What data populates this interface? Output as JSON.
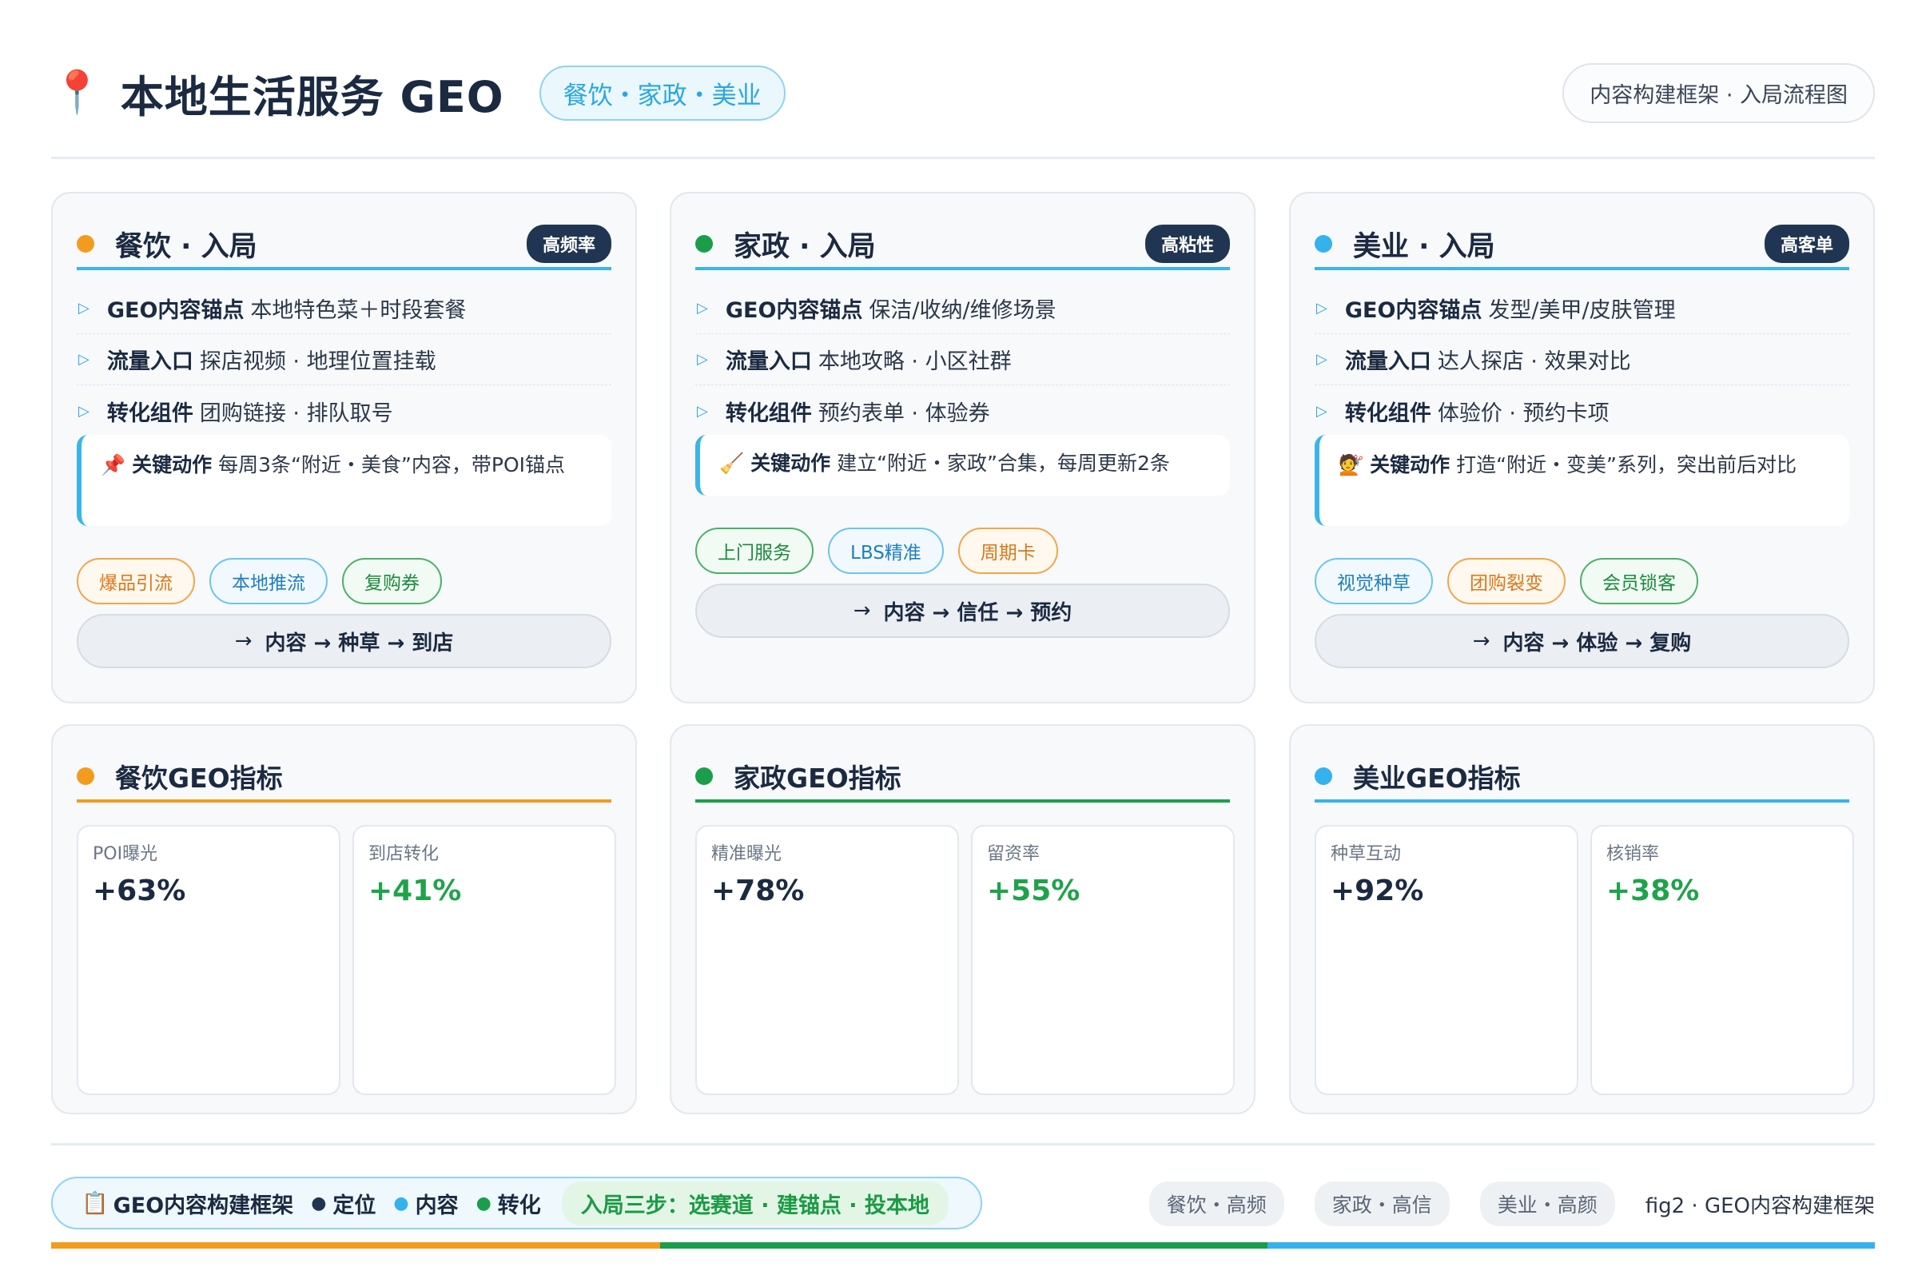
{
  "header": {
    "pin_icon": "📍",
    "title": "本地生活服务 GEO",
    "scope": "餐饮・家政・美业",
    "ref": "内容构建框架 · 入局流程图"
  },
  "colors": {
    "orange": "#f29c1f",
    "green": "#1b9e4b",
    "blue": "#35b2ec"
  },
  "cards": [
    {
      "title": "餐饮 · 入局",
      "badge": "高频率",
      "rows": [
        {
          "label": "GEO内容锚点",
          "text": "本地特色菜＋时段套餐"
        },
        {
          "label": "流量入口",
          "text": "探店视频 · 地理位置挂载"
        },
        {
          "label": "转化组件",
          "text": "团购链接 · 排队取号"
        }
      ],
      "key": {
        "icon": "📌",
        "label": "关键动作",
        "text": "每周3条“附近・美食”内容，带POI锚点"
      },
      "tags": [
        "爆品引流",
        "本地推流",
        "复购券"
      ],
      "flow": "内容 → 种草 → 到店"
    },
    {
      "title": "家政 · 入局",
      "badge": "高粘性",
      "rows": [
        {
          "label": "GEO内容锚点",
          "text": "保洁/收纳/维修场景"
        },
        {
          "label": "流量入口",
          "text": "本地攻略 · 小区社群"
        },
        {
          "label": "转化组件",
          "text": "预约表单 · 体验券"
        }
      ],
      "key": {
        "icon": "🧹",
        "label": "关键动作",
        "text": "建立“附近・家政”合集，每周更新2条"
      },
      "tags": [
        "上门服务",
        "LBS精准",
        "周期卡"
      ],
      "flow": "内容 → 信任 → 预约"
    },
    {
      "title": "美业 · 入局",
      "badge": "高客单",
      "rows": [
        {
          "label": "GEO内容锚点",
          "text": "发型/美甲/皮肤管理"
        },
        {
          "label": "流量入口",
          "text": "达人探店 · 效果对比"
        },
        {
          "label": "转化组件",
          "text": "体验价 · 预约卡项"
        }
      ],
      "key": {
        "icon": "💇",
        "label": "关键动作",
        "text": "打造“附近・变美”系列，突出前后对比"
      },
      "tags": [
        "视觉种草",
        "团购裂变",
        "会员锁客"
      ],
      "flow": "内容 → 体验 → 复购"
    }
  ],
  "metrics": [
    {
      "title": "餐饮GEO指标",
      "items": [
        {
          "label": "POI曝光",
          "value": "+63%"
        },
        {
          "label": "到店转化",
          "value": "+41%"
        }
      ]
    },
    {
      "title": "家政GEO指标",
      "items": [
        {
          "label": "精准曝光",
          "value": "+78%"
        },
        {
          "label": "留资率",
          "value": "+55%"
        }
      ]
    },
    {
      "title": "美业GEO指标",
      "items": [
        {
          "label": "种草互动",
          "value": "+92%"
        },
        {
          "label": "核销率",
          "value": "+38%"
        }
      ]
    }
  ],
  "footer": {
    "icon": "📋",
    "framework": "GEO内容构建框架",
    "stages": [
      "定位",
      "内容",
      "转化"
    ],
    "steps": "入局三步：选赛道 · 建锚点 · 投本地",
    "tags": [
      "餐饮・高频",
      "家政・高信",
      "美业・高颜"
    ],
    "fig": "fig2 · GEO内容构建框架"
  }
}
